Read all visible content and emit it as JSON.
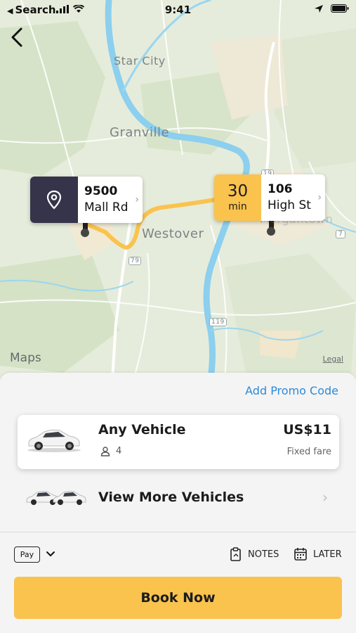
{
  "status_bar": {
    "back_label": "Search",
    "time": "9:41"
  },
  "map": {
    "place_labels": [
      "Star City",
      "Granville",
      "Westover",
      "Morgantown"
    ],
    "route_shields": [
      "79",
      "19",
      "119",
      "7"
    ],
    "pickup": {
      "number": "9500",
      "street": "Mall Rd"
    },
    "dropoff": {
      "eta_value": "30",
      "eta_unit": "min",
      "number": "106",
      "street": "High St"
    },
    "maps_logo": "Maps",
    "legal": "Legal",
    "route_color": "#f9c34e",
    "river_color": "#8ccfee"
  },
  "sheet": {
    "promo_label": "Add Promo Code",
    "vehicle": {
      "name": "Any Vehicle",
      "passengers": "4",
      "price": "US$11",
      "fare_type": "Fixed fare"
    },
    "more_vehicles_label": "View More Vehicles",
    "payment": {
      "method_label": "Pay"
    },
    "notes_label": "NOTES",
    "later_label": "LATER",
    "book_label": "Book Now"
  },
  "colors": {
    "accent": "#f9c34e",
    "link": "#2d8ad6",
    "pickup_box": "#35344a"
  }
}
